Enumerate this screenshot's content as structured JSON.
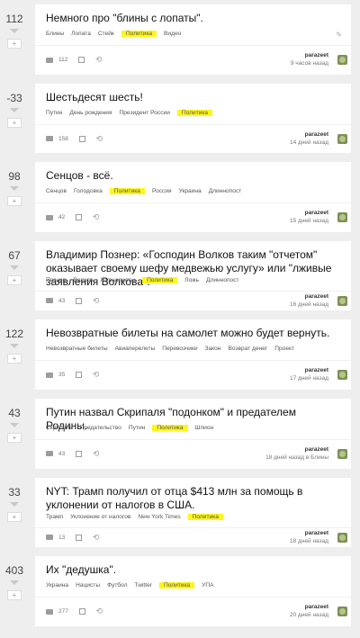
{
  "author": "parazeet",
  "posts": [
    {
      "score": "112",
      "title": "Немного про \"блины с лопаты\".",
      "tags": [
        {
          "t": "Блины"
        },
        {
          "t": "Лопата"
        },
        {
          "t": "Стейк"
        },
        {
          "t": "Политика",
          "hl": true
        },
        {
          "t": "Видео"
        }
      ],
      "comments": "112",
      "time": "9 часов назад",
      "pencil": "✎"
    },
    {
      "score": "-33",
      "title": "Шестьдесят шесть!",
      "tags": [
        {
          "t": "Путин"
        },
        {
          "t": "День рождения"
        },
        {
          "t": "Президент России"
        },
        {
          "t": "Политика",
          "hl": true
        }
      ],
      "comments": "158",
      "time": "14 дней назад"
    },
    {
      "score": "98",
      "title": "Сенцов - всё.",
      "tags": [
        {
          "t": "Сенцов"
        },
        {
          "t": "Голодовка"
        },
        {
          "t": "Политика",
          "hl": true
        },
        {
          "t": "Россия"
        },
        {
          "t": "Украина"
        },
        {
          "t": "Длиннопост"
        }
      ],
      "comments": "42",
      "time": "15 дней назад"
    },
    {
      "score": "67",
      "title": "Владимир Познер: «Господин Волков таким \"отчетом\" оказывает своему шефу медвежью услугу» или \"лживые заявления Волкова\".",
      "tags": [
        {
          "t": "Познер"
        },
        {
          "t": "Волков"
        },
        {
          "t": "Журналисты"
        },
        {
          "t": "Политика",
          "hl": true
        },
        {
          "t": "Ложь"
        },
        {
          "t": "Длиннопост"
        }
      ],
      "comments": "43",
      "time": "16 дней назад"
    },
    {
      "score": "122",
      "title": "Невозвратные билеты на самолет можно будет вернуть.",
      "tags": [
        {
          "t": "Невозвратные билеты"
        },
        {
          "t": "Авиаперелеты"
        },
        {
          "t": "Перевозчики"
        },
        {
          "t": "Закон"
        },
        {
          "t": "Возврат денег"
        },
        {
          "t": "Проект"
        }
      ],
      "comments": "35",
      "time": "17 дней назад"
    },
    {
      "score": "43",
      "title": "Путин назвал Скрипаля \"подонком\" и предателем Родины.",
      "tags": [
        {
          "t": "Скрипаль"
        },
        {
          "t": "Предательство"
        },
        {
          "t": "Путин"
        },
        {
          "t": "Политика",
          "hl": true
        },
        {
          "t": "Шпион"
        }
      ],
      "comments": "43",
      "time": "18 дней назад в Блины"
    },
    {
      "score": "33",
      "title": "NYT: Трамп получил от отца $413 млн за помощь в уклонении от налогов в США.",
      "tags": [
        {
          "t": "Трамп"
        },
        {
          "t": "Уклонение от налогов"
        },
        {
          "t": "New York Times"
        },
        {
          "t": "Политика",
          "hl": true
        }
      ],
      "comments": "13",
      "time": "18 дней назад"
    },
    {
      "score": "403",
      "title": "Их \"дедушка\".",
      "tags": [
        {
          "t": "Украина"
        },
        {
          "t": "Нацисты"
        },
        {
          "t": "Футбол"
        },
        {
          "t": "Twitter"
        },
        {
          "t": "Политика",
          "hl": true
        },
        {
          "t": "УПА"
        }
      ],
      "comments": "277",
      "time": "20 дней назад"
    }
  ]
}
